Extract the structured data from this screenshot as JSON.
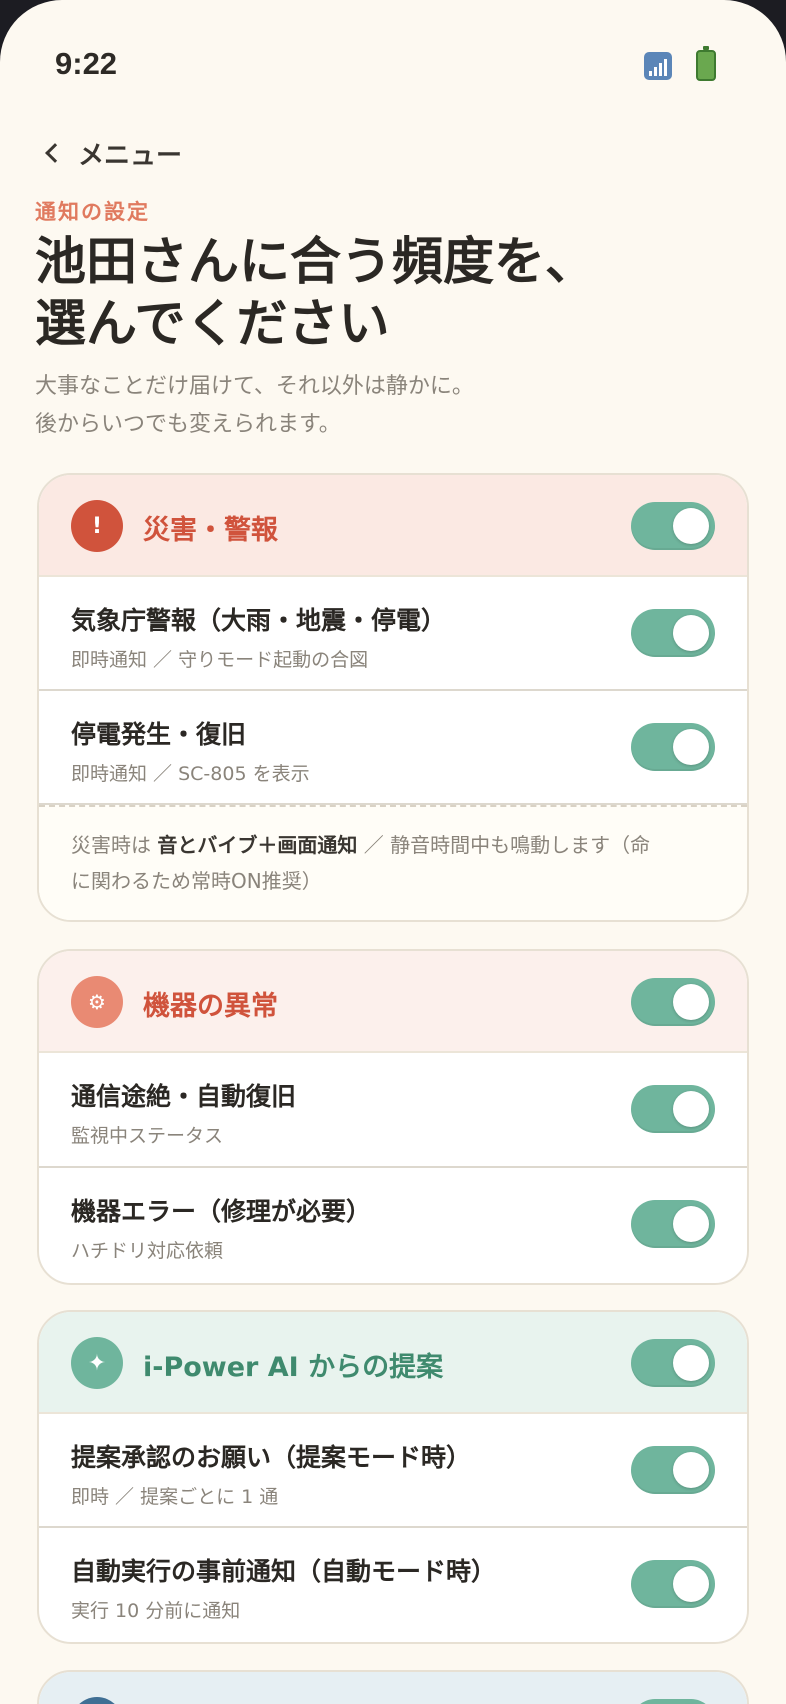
{
  "status_bar": {
    "time": "9:22",
    "signal_icon": "signal-icon",
    "battery_icon": "battery-icon"
  },
  "nav": {
    "back_label": "メニュー"
  },
  "header": {
    "eyebrow": "通知の設定",
    "title_line1": "池田さんに合う頻度を、",
    "title_line2": "選んでください",
    "subtitle_line1": "大事なことだけ届けて、それ以外は静かに。",
    "subtitle_line2": "後からいつでも変えられます。"
  },
  "colors": {
    "accent_red": "#d0533c",
    "accent_coral": "#e07a5f",
    "toggle_on": "#6fb59d",
    "accent_green": "#3f8a6e",
    "background": "#fdf9f1"
  },
  "sections": [
    {
      "label": "災害・警報",
      "icon": "alert-icon",
      "icon_glyph": "!",
      "enabled": true,
      "items": [
        {
          "title": "気象庁警報（大雨・地震・停電）",
          "sub": "即時通知 ／ 守りモード起動の合図",
          "enabled": true
        },
        {
          "title": "停電発生・復旧",
          "sub": "即時通知 ／ SC-805 を表示",
          "enabled": true
        }
      ],
      "note": {
        "prefix": "災害時は ",
        "bold": "音とバイブ＋画面通知",
        "line1_rest": " ／ 静音時間中も鳴動します（命",
        "line2": "に関わるため常時ON推奨）"
      }
    },
    {
      "label": "機器の異常",
      "icon": "gear-icon",
      "icon_glyph": "⚙",
      "enabled": true,
      "items": [
        {
          "title": "通信途絶・自動復旧",
          "sub": "監視中ステータス",
          "enabled": true
        },
        {
          "title": "機器エラー（修理が必要）",
          "sub": "ハチドリ対応依頼",
          "enabled": true
        }
      ]
    },
    {
      "label": "i-Power AI からの提案",
      "icon": "sparkle-icon",
      "icon_glyph": "✦",
      "enabled": true,
      "items": [
        {
          "title": "提案承認のお願い（提案モード時）",
          "sub": "即時 ／ 提案ごとに 1 通",
          "enabled": true
        },
        {
          "title": "自動実行の事前通知（自動モード時）",
          "sub": "実行 10 分前に通知",
          "enabled": true
        }
      ]
    }
  ]
}
